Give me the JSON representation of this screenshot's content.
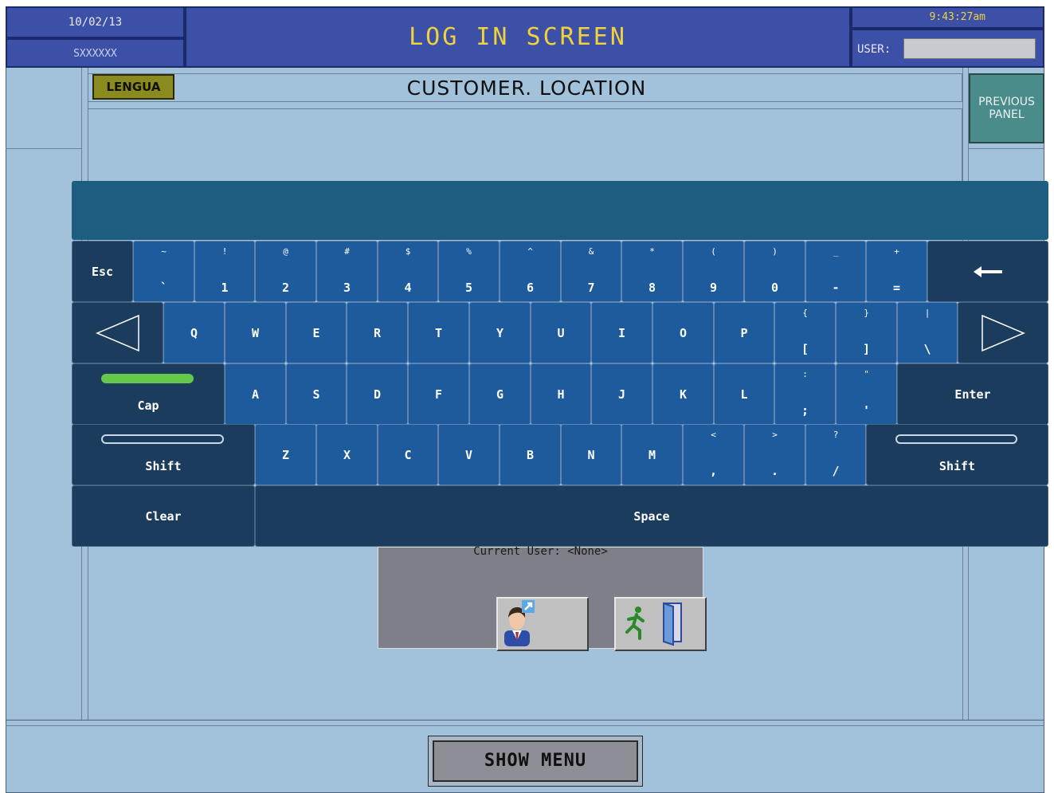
{
  "header": {
    "date": "10/02/13",
    "site": "SXXXXXX",
    "title": "LOG IN SCREEN",
    "time": "9:43:27am",
    "user_label": "USER:",
    "user_value": ""
  },
  "panel": {
    "lengua": "LENGUA",
    "location_title": "CUSTOMER. LOCATION",
    "previous_panel": "PREVIOUS PANEL"
  },
  "keyboard": {
    "row1": [
      {
        "main": "Esc",
        "shift": ""
      },
      {
        "main": "`",
        "shift": "~"
      },
      {
        "main": "1",
        "shift": "!"
      },
      {
        "main": "2",
        "shift": "@"
      },
      {
        "main": "3",
        "shift": "#"
      },
      {
        "main": "4",
        "shift": "$"
      },
      {
        "main": "5",
        "shift": "%"
      },
      {
        "main": "6",
        "shift": "^"
      },
      {
        "main": "7",
        "shift": "&"
      },
      {
        "main": "8",
        "shift": "*"
      },
      {
        "main": "9",
        "shift": "("
      },
      {
        "main": "0",
        "shift": ")"
      },
      {
        "main": "-",
        "shift": "_"
      },
      {
        "main": "=",
        "shift": "+"
      },
      {
        "main": "←",
        "shift": ""
      }
    ],
    "row2": [
      {
        "main": "◁",
        "shift": ""
      },
      {
        "main": "Q",
        "shift": ""
      },
      {
        "main": "W",
        "shift": ""
      },
      {
        "main": "E",
        "shift": ""
      },
      {
        "main": "R",
        "shift": ""
      },
      {
        "main": "T",
        "shift": ""
      },
      {
        "main": "Y",
        "shift": ""
      },
      {
        "main": "U",
        "shift": ""
      },
      {
        "main": "I",
        "shift": ""
      },
      {
        "main": "O",
        "shift": ""
      },
      {
        "main": "P",
        "shift": ""
      },
      {
        "main": "[",
        "shift": "{"
      },
      {
        "main": "]",
        "shift": "}"
      },
      {
        "main": "\\",
        "shift": "|"
      },
      {
        "main": "▷",
        "shift": ""
      }
    ],
    "row3": [
      {
        "main": "Cap",
        "shift": ""
      },
      {
        "main": "A",
        "shift": ""
      },
      {
        "main": "S",
        "shift": ""
      },
      {
        "main": "D",
        "shift": ""
      },
      {
        "main": "F",
        "shift": ""
      },
      {
        "main": "G",
        "shift": ""
      },
      {
        "main": "H",
        "shift": ""
      },
      {
        "main": "J",
        "shift": ""
      },
      {
        "main": "K",
        "shift": ""
      },
      {
        "main": "L",
        "shift": ""
      },
      {
        "main": ";",
        "shift": ":"
      },
      {
        "main": "'",
        "shift": "\""
      },
      {
        "main": "Enter",
        "shift": ""
      }
    ],
    "row4": [
      {
        "main": "Shift",
        "shift": ""
      },
      {
        "main": "Z",
        "shift": ""
      },
      {
        "main": "X",
        "shift": ""
      },
      {
        "main": "C",
        "shift": ""
      },
      {
        "main": "V",
        "shift": ""
      },
      {
        "main": "B",
        "shift": ""
      },
      {
        "main": "N",
        "shift": ""
      },
      {
        "main": "M",
        "shift": ""
      },
      {
        "main": ",",
        "shift": "<"
      },
      {
        "main": ".",
        "shift": ">"
      },
      {
        "main": "/",
        "shift": "?"
      },
      {
        "main": "Shift",
        "shift": ""
      }
    ],
    "row5": [
      {
        "main": "Clear",
        "shift": ""
      },
      {
        "main": "Space",
        "shift": ""
      }
    ],
    "caps_on": true
  },
  "login": {
    "current_user": "Current User: <None>"
  },
  "footer": {
    "show_menu": "SHOW MENU"
  },
  "colors": {
    "background": "#a2c2dc",
    "header": "#3c50a8",
    "title": "#f2d23a",
    "key": "#1e5b9c",
    "key_dark": "#1b3c5c"
  }
}
